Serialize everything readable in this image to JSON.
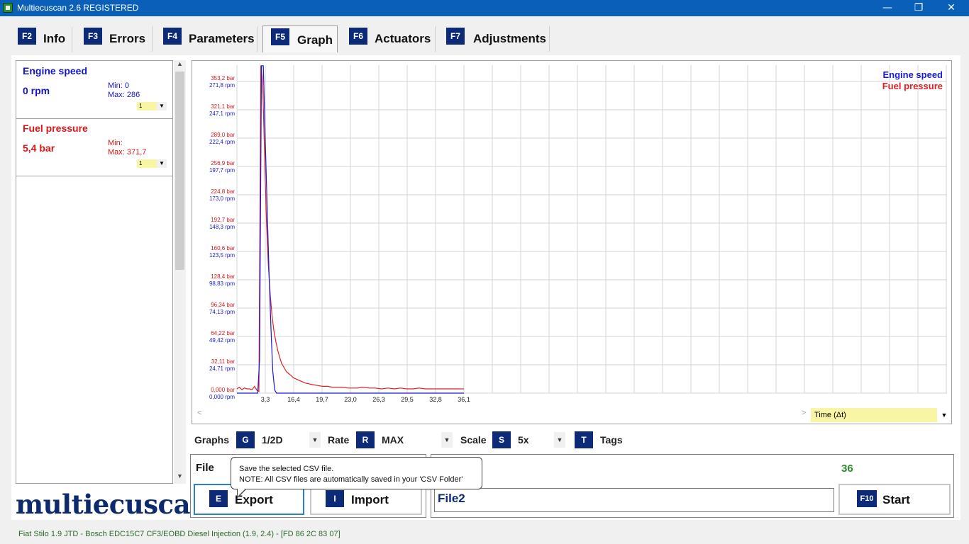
{
  "window": {
    "title": "Multiecuscan 2.6 REGISTERED",
    "minimize": "—",
    "maximize": "❐",
    "close": "✕"
  },
  "tabs": [
    {
      "key": "F2",
      "label": "Info"
    },
    {
      "key": "F3",
      "label": "Errors"
    },
    {
      "key": "F4",
      "label": "Parameters"
    },
    {
      "key": "F5",
      "label": "Graph",
      "active": true
    },
    {
      "key": "F6",
      "label": "Actuators"
    },
    {
      "key": "F7",
      "label": "Adjustments"
    }
  ],
  "params": [
    {
      "name": "Engine speed",
      "value": "0 rpm",
      "min": "Min: 0",
      "max": "Max: 286",
      "selector": "1",
      "color": "#1515c8"
    },
    {
      "name": "Fuel pressure",
      "value": "5,4 bar",
      "min": "Min:",
      "max": "Max: 371,7",
      "selector": "1",
      "color": "#d81818"
    }
  ],
  "logo": "multiecuscan",
  "chart_data": {
    "type": "line",
    "legend": [
      "Engine speed",
      "Fuel pressure"
    ],
    "legend_position": "top-right",
    "grid": true,
    "x_ticks": [
      "3,3",
      "16,4",
      "19,7",
      "23,0",
      "26,3",
      "29,5",
      "32,8",
      "36,1"
    ],
    "y_ticks_bar": [
      "0,000 bar",
      "32,11 bar",
      "64,22 bar",
      "96,34 bar",
      "128,4 bar",
      "160,6 bar",
      "192,7 bar",
      "224,8 bar",
      "256,9 bar",
      "289,0 bar",
      "321,1 bar",
      "353,2 bar"
    ],
    "y_ticks_rpm": [
      "0,000 rpm",
      "24,71 rpm",
      "49,42 rpm",
      "74,13 rpm",
      "98,83 rpm",
      "123,5 rpm",
      "148,3 rpm",
      "173,0 rpm",
      "197,7 rpm",
      "222,4 rpm",
      "247,1 rpm",
      "271,8 rpm"
    ],
    "ylim_bar": [
      0,
      385.3
    ],
    "ylim_rpm": [
      0,
      296.5
    ],
    "xlim": [
      0,
      36.1
    ],
    "series": [
      {
        "name": "Fuel pressure",
        "unit": "bar",
        "color": "#e02020",
        "x": [
          0,
          0.4,
          0.8,
          1.2,
          1.6,
          2.0,
          2.4,
          2.8,
          3.2,
          3.5,
          3.8,
          4.1,
          4.4,
          4.7,
          5.0,
          5.3,
          5.6,
          5.9,
          6.2,
          6.5,
          6.8,
          7.1,
          7.5,
          7.9,
          8.4,
          9.0,
          9.6,
          10.2,
          10.8,
          11.4,
          12.0,
          12.8,
          13.6,
          14.4,
          15.2,
          16.0,
          16.8,
          17.6,
          18.4,
          19.2,
          20.0,
          21.0,
          22.0,
          23.0,
          24.0,
          25.0,
          26.0,
          27.0,
          28.0,
          29.0,
          30.0,
          31.0,
          32.0,
          33.0,
          34.0,
          35.0,
          36.1
        ],
        "values": [
          5,
          7,
          4,
          6,
          5,
          5,
          4,
          8,
          3,
          2,
          385,
          365,
          280,
          200,
          150,
          115,
          90,
          72,
          60,
          50,
          42,
          35,
          30,
          25,
          22,
          18,
          16,
          14,
          12,
          11,
          10,
          9,
          8,
          8,
          7,
          7,
          7,
          6,
          6,
          6,
          7,
          6,
          6,
          5,
          6,
          5,
          6,
          5,
          5,
          6,
          5,
          5,
          5,
          5,
          5,
          5,
          5
        ]
      },
      {
        "name": "Engine speed",
        "unit": "rpm",
        "color": "#1a1ad8",
        "x": [
          0,
          3.0,
          3.3,
          3.6,
          3.9,
          4.2,
          4.5,
          4.8,
          5.1,
          5.4,
          5.7,
          6.0,
          6.3,
          6.6,
          7.0,
          36.1
        ],
        "values": [
          0,
          0,
          0,
          30,
          296,
          296,
          230,
          170,
          110,
          60,
          20,
          3,
          0,
          0,
          0,
          0
        ]
      }
    ]
  },
  "graph": {
    "scroll_left": "<",
    "scroll_right": ">",
    "time_axis": "Time (Δt)"
  },
  "controls": {
    "graphs_label": "Graphs",
    "graphs_key": "G",
    "graphs_value": "1/2D",
    "rate_label": "Rate",
    "rate_key": "R",
    "rate_value": "MAX",
    "scale_label": "Scale",
    "scale_key": "S",
    "scale_value": "5x",
    "tags_key": "T",
    "tags_label": "Tags"
  },
  "file": {
    "label": "File",
    "export_key": "E",
    "export_label": "Export",
    "import_key": "I",
    "import_label": "Import"
  },
  "recording": {
    "counter": "36",
    "filename": "File2",
    "start_key": "F10",
    "start_label": "Start"
  },
  "tooltip": {
    "line1": "Save the selected CSV file.",
    "line2": "NOTE: All CSV files are automatically saved in your 'CSV Folder'"
  },
  "status": "Fiat Stilo 1.9 JTD - Bosch EDC15C7 CF3/EOBD Diesel Injection (1.9, 2.4) - [FD 86 2C 83 07]"
}
